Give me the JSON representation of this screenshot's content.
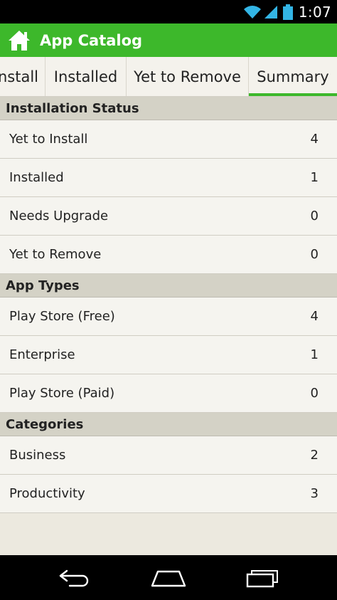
{
  "status_bar": {
    "time": "1:07",
    "icons": [
      "wifi-icon",
      "signal-icon",
      "battery-icon"
    ]
  },
  "action_bar": {
    "title": "App Catalog",
    "icon": "home-icon",
    "color": "#3db82b"
  },
  "tabs": [
    {
      "label": "nstall",
      "active": false
    },
    {
      "label": "Installed",
      "active": false
    },
    {
      "label": "Yet to Remove",
      "active": false
    },
    {
      "label": "Summary",
      "active": true
    }
  ],
  "sections": [
    {
      "title": "Installation Status",
      "rows": [
        {
          "label": "Yet to Install",
          "count": "4"
        },
        {
          "label": "Installed",
          "count": "1"
        },
        {
          "label": "Needs Upgrade",
          "count": "0"
        },
        {
          "label": "Yet to Remove",
          "count": "0"
        }
      ]
    },
    {
      "title": "App Types",
      "rows": [
        {
          "label": "Play Store (Free)",
          "count": "4"
        },
        {
          "label": "Enterprise",
          "count": "1"
        },
        {
          "label": "Play Store (Paid)",
          "count": "0"
        }
      ]
    },
    {
      "title": "Categories",
      "rows": [
        {
          "label": "Business",
          "count": "2"
        },
        {
          "label": "Productivity",
          "count": "3"
        }
      ]
    }
  ],
  "nav_bar": {
    "icons": [
      "back-icon",
      "home-nav-icon",
      "recent-apps-icon"
    ]
  }
}
